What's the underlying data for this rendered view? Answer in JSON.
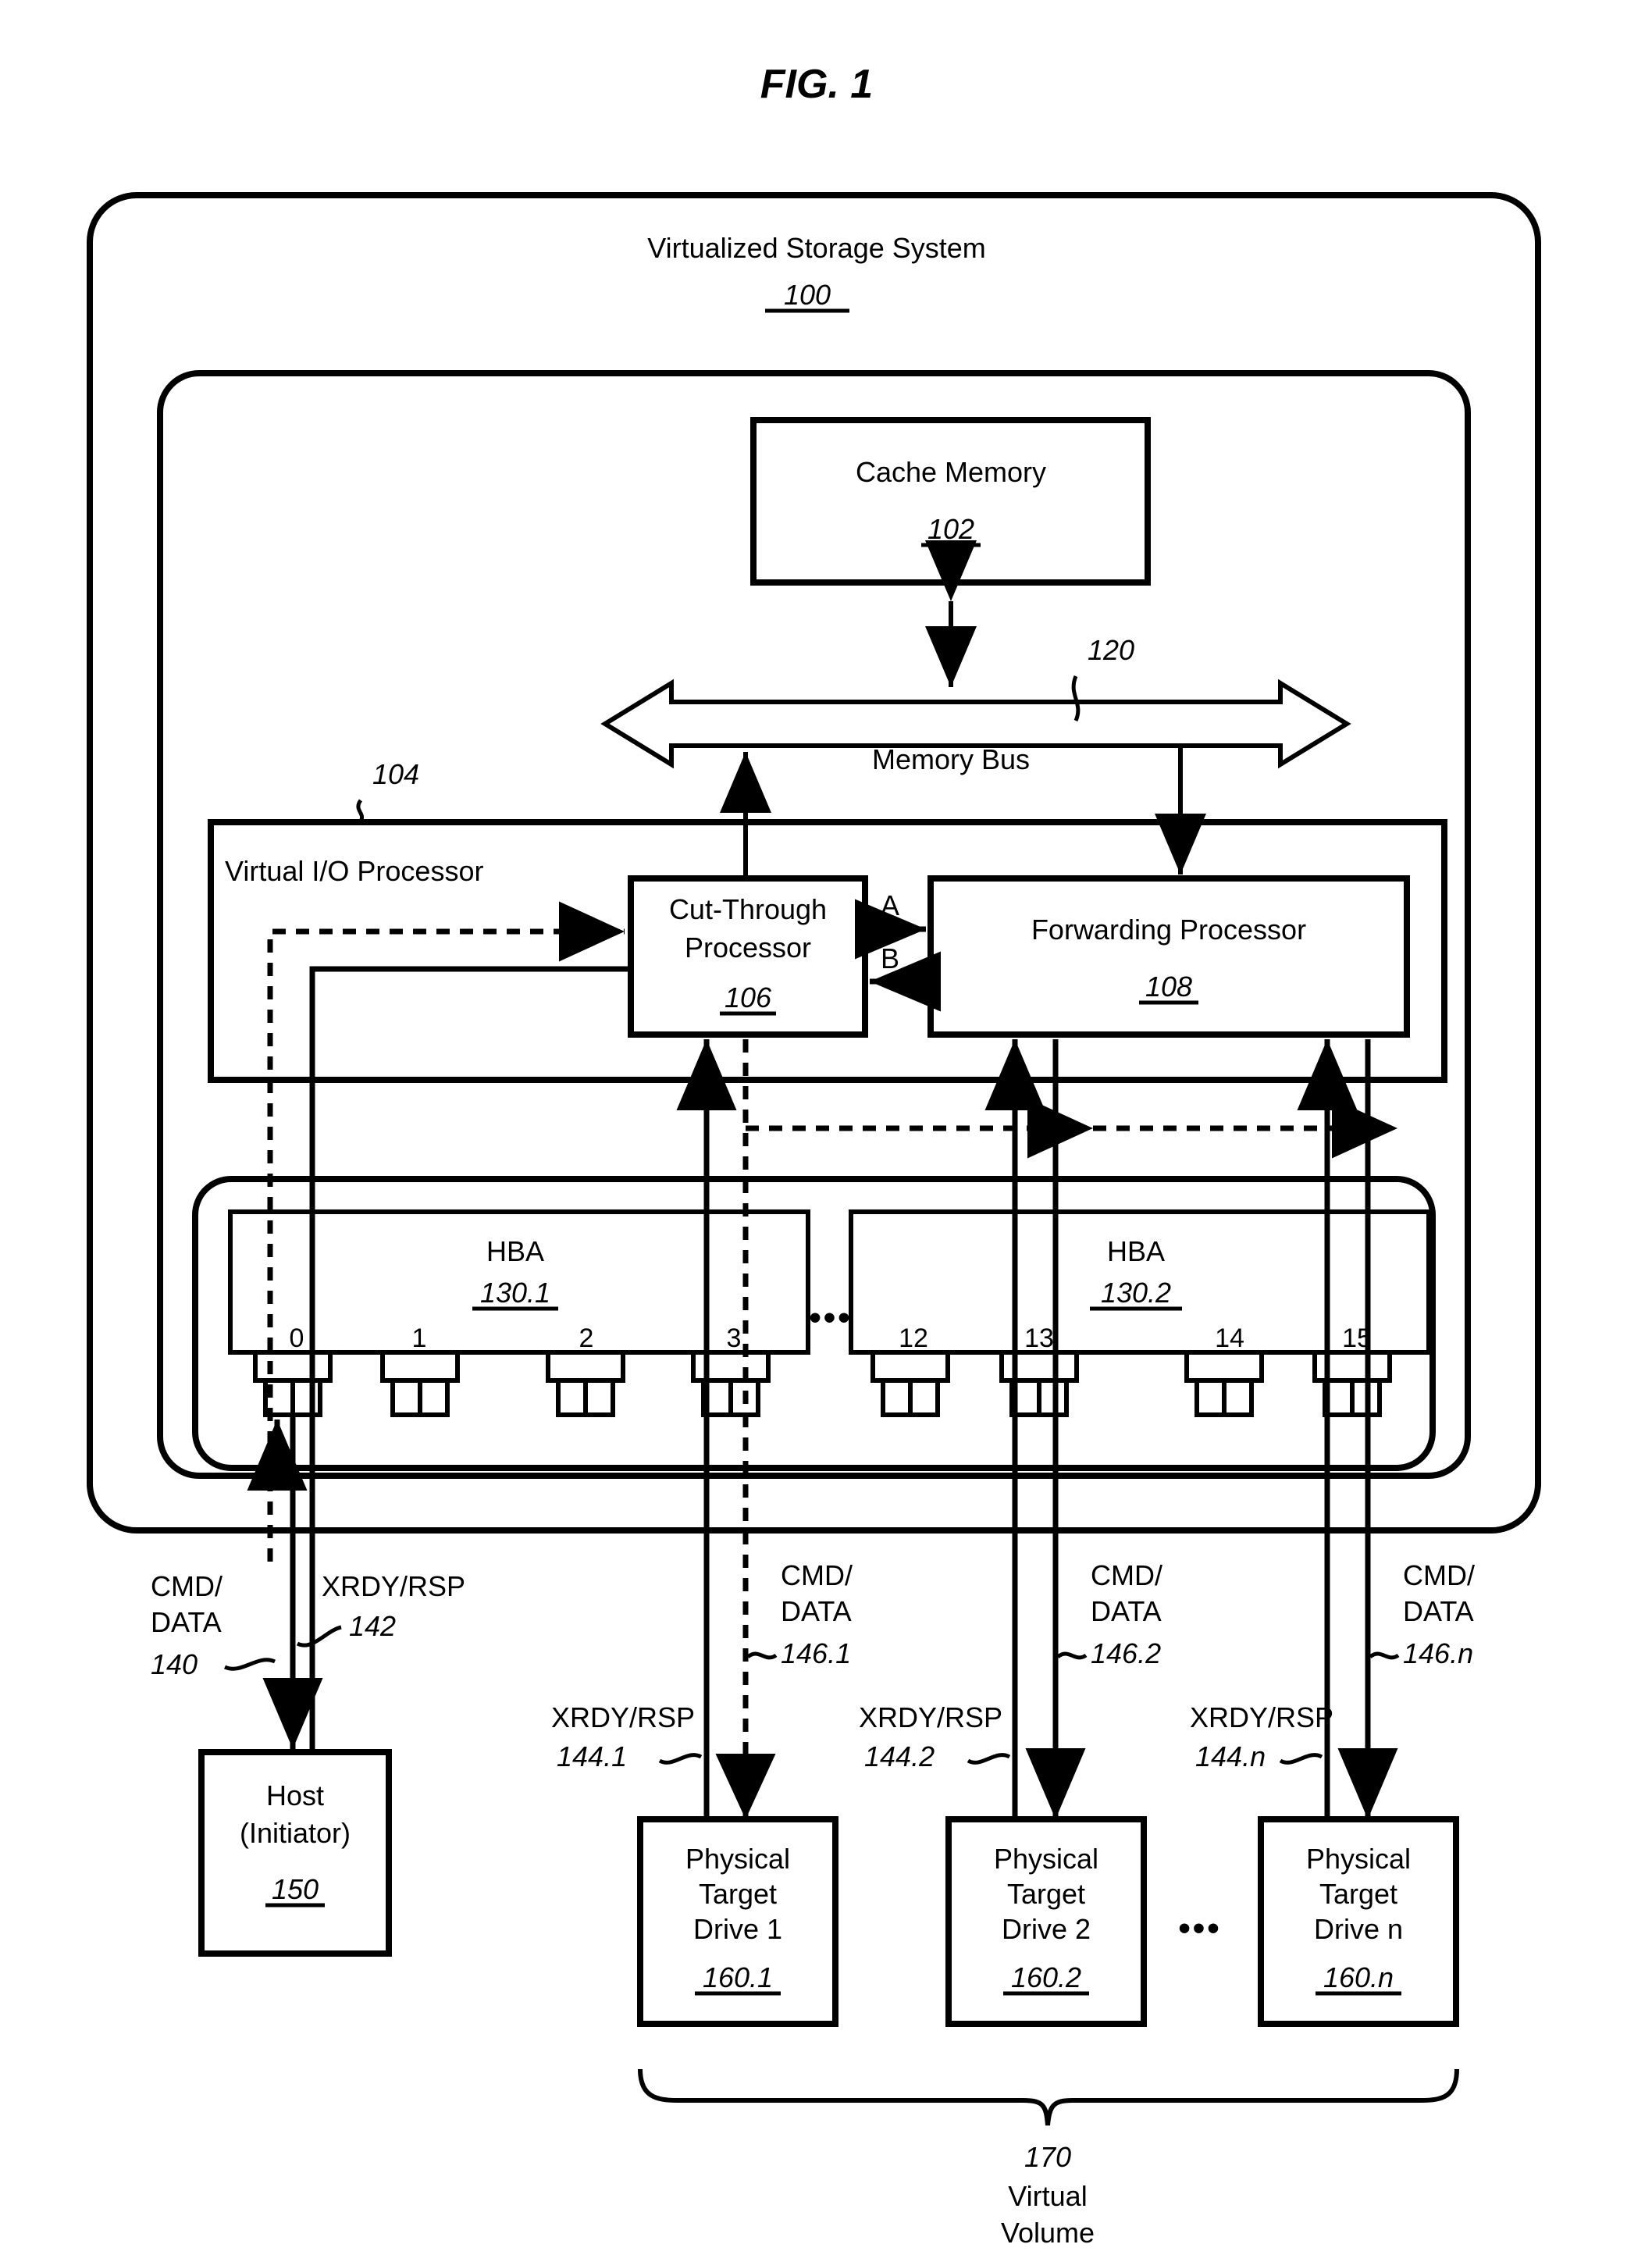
{
  "figure": {
    "title": "FIG. 1"
  },
  "system": {
    "label": "Virtualized Storage System",
    "ref": "100"
  },
  "cache": {
    "label": "Cache Memory",
    "ref": "102"
  },
  "memory_bus": {
    "label": "Memory Bus",
    "ref": "120"
  },
  "vio": {
    "label": "Virtual I/O Processor",
    "ref": "104"
  },
  "cut_through": {
    "line1": "Cut-Through",
    "line2": "Processor",
    "ref": "106"
  },
  "forwarding": {
    "label": "Forwarding Processor",
    "ref": "108"
  },
  "links": {
    "a": "A",
    "b": "B"
  },
  "hba": [
    {
      "label": "HBA",
      "ref": "130.1",
      "ports": [
        "0",
        "1",
        "2",
        "3"
      ]
    },
    {
      "label": "HBA",
      "ref": "130.2",
      "ports": [
        "12",
        "13",
        "14",
        "15"
      ]
    }
  ],
  "hba_ellipsis": "•••",
  "host": {
    "line1": "Host",
    "line2": "(Initiator)",
    "ref": "150"
  },
  "host_links": {
    "cmd_line1": "CMD/",
    "cmd_line2": "DATA",
    "cmd_ref": "140",
    "rsp_label": "XRDY/RSP",
    "rsp_ref": "142"
  },
  "drive_links": [
    {
      "cmd_line1": "CMD/",
      "cmd_line2": "DATA",
      "cmd_ref": "146.1",
      "rsp_label": "XRDY/RSP",
      "rsp_ref": "144.1"
    },
    {
      "cmd_line1": "CMD/",
      "cmd_line2": "DATA",
      "cmd_ref": "146.2",
      "rsp_label": "XRDY/RSP",
      "rsp_ref": "144.2"
    },
    {
      "cmd_line1": "CMD/",
      "cmd_line2": "DATA",
      "cmd_ref": "146.n",
      "rsp_label": "XRDY/RSP",
      "rsp_ref": "144.n"
    }
  ],
  "drives": [
    {
      "line1": "Physical",
      "line2": "Target",
      "line3": "Drive 1",
      "ref": "160.1"
    },
    {
      "line1": "Physical",
      "line2": "Target",
      "line3": "Drive 2",
      "ref": "160.2"
    },
    {
      "line1": "Physical",
      "line2": "Target",
      "line3": "Drive n",
      "ref": "160.n"
    }
  ],
  "drives_ellipsis": "•••",
  "volume": {
    "ref": "170",
    "line1": "Virtual",
    "line2": "Volume"
  }
}
